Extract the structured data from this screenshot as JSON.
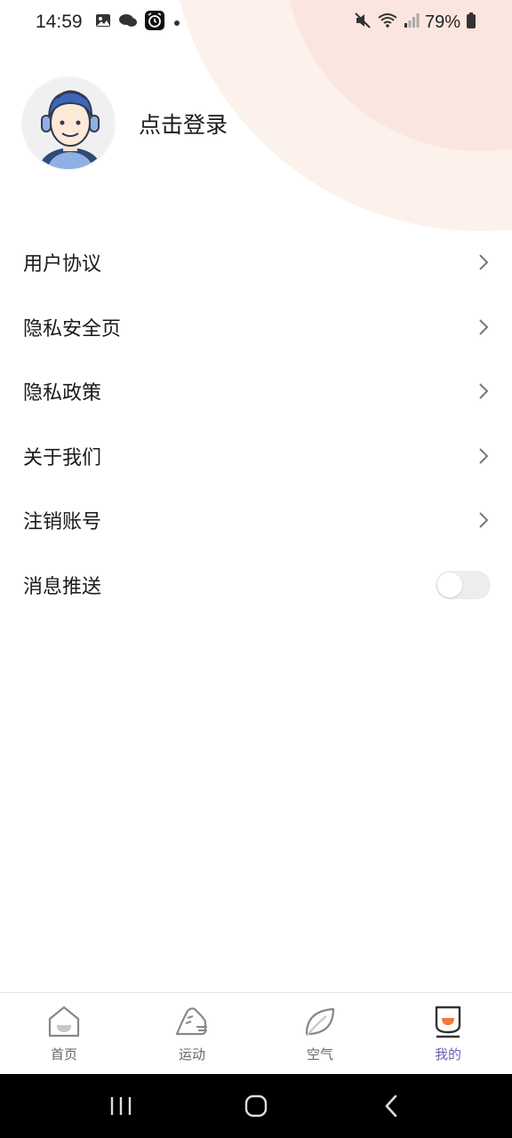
{
  "status_bar": {
    "time": "14:59",
    "battery": "79%",
    "icons_left": [
      "gallery-icon",
      "chat-bubble-icon",
      "alarm-app-icon",
      "notification-dot-icon"
    ],
    "icons_right": [
      "mute-icon",
      "wifi-icon",
      "signal-icon",
      "battery-icon"
    ]
  },
  "profile": {
    "avatar_icon": "user-avatar-icon",
    "login_label": "点击登录"
  },
  "menu": {
    "items": [
      {
        "label": "用户协议",
        "trailing": "chevron-right-icon"
      },
      {
        "label": "隐私安全页",
        "trailing": "chevron-right-icon"
      },
      {
        "label": "隐私政策",
        "trailing": "chevron-right-icon"
      },
      {
        "label": "关于我们",
        "trailing": "chevron-right-icon"
      },
      {
        "label": "注销账号",
        "trailing": "chevron-right-icon"
      }
    ],
    "push": {
      "label": "消息推送",
      "enabled": false
    }
  },
  "tabs": [
    {
      "label": "首页",
      "icon": "home-icon",
      "active": false
    },
    {
      "label": "运动",
      "icon": "sneaker-icon",
      "active": false
    },
    {
      "label": "空气",
      "icon": "leaf-icon",
      "active": false
    },
    {
      "label": "我的",
      "icon": "profile-cup-icon",
      "active": true
    }
  ],
  "colors": {
    "accent": "#6d62b5",
    "tab_inactive": "#666666",
    "highlight_orange": "#f4783a",
    "header_tint": "#fdf1ec"
  },
  "nav_bar": [
    "recent-apps-icon",
    "home-button-icon",
    "back-icon"
  ]
}
